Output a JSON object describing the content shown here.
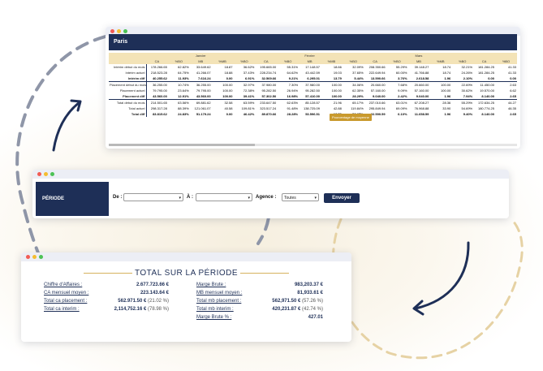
{
  "window1": {
    "header_title": "Paris",
    "months": [
      "Janvier",
      "Février",
      "Mars"
    ],
    "columns": [
      "CA",
      "%BO",
      "MB",
      "%MB",
      "%BO"
    ],
    "rows": [
      {
        "label": "Intérim début du mois",
        "values": [
          "178.266.65",
          "62.82%",
          "33.649.62",
          "18.87",
          "36.62%",
          "195.665.00",
          "55.31%",
          "17.148.57",
          "18.66",
          "32.09%",
          "208.350.66",
          "55.29%",
          "39.148.27",
          "18.74",
          "32.21%",
          "181.284.25",
          "41.33"
        ]
      },
      {
        "label": "Intérim actuel",
        "values": [
          "218.523.28",
          "64.75%",
          "41.266.07",
          "18.88",
          "37.43%",
          "228.234.74",
          "64.62%",
          "43.442.59",
          "19.03",
          "37.65%",
          "222.649.94",
          "60.00%",
          "41.766.88",
          "18.74",
          "24.26%",
          "181.284.25",
          "41.33"
        ]
      },
      {
        "label": "Intérim diff",
        "values": [
          "40.255.62",
          "11.93%",
          "7.616.24",
          "0.00",
          "6.91%",
          "32.569.66",
          "9.21%",
          "6.295.01",
          "13.79",
          "5.44%",
          "13.590.66",
          "3.76%",
          "2.618.58",
          "1.96",
          "2.10%",
          "0.00",
          "0.00"
        ]
      },
      {
        "label": "Placement début du mois",
        "values": [
          "36.255.00",
          "10.74%",
          "36.255.00",
          "100.00",
          "32.97%",
          "37.980.00",
          "7.30%",
          "37.980.00",
          "100.00",
          "34.06%",
          "20.660.00",
          "7.68%",
          "20.660.00",
          "100.00",
          "22.69%",
          "11.450.00",
          "2.63"
        ]
      },
      {
        "label": "Placement actuel",
        "values": [
          "79.795.00",
          "23.64%",
          "79.795.00",
          "100.00",
          "72.38%",
          "95.282.50",
          "26.94%",
          "95.282.50",
          "100.00",
          "62.35%",
          "57.160.00",
          "9.09%",
          "57.160.00",
          "100.00",
          "30.62%",
          "19.570.00",
          "6.62"
        ]
      },
      {
        "label": "Placement diff",
        "values": [
          "43.560.00",
          "12.91%",
          "43.560.00",
          "100.00",
          "39.41%",
          "57.302.50",
          "16.98%",
          "57.410.00",
          "100.00",
          "28.29%",
          "9.040.00",
          "2.42%",
          "9.040.00",
          "1.96",
          "7.94%",
          "8.140.00",
          "2.65"
        ]
      },
      {
        "label": "Total début du mois",
        "values": [
          "214.501.65",
          "63.56%",
          "69.881.62",
          "32.58",
          "63.59%",
          "233.647.50",
          "62.63%",
          "85.128.57",
          "21.96",
          "65.17%",
          "237.010.66",
          "63.01%",
          "67.208.27",
          "28.36",
          "55.29%",
          "172.634.25",
          "44.27"
        ]
      },
      {
        "label": "Total actuel",
        "values": [
          "298.317.28",
          "88.39%",
          "121.061.07",
          "40.58",
          "109.81%",
          "323.517.24",
          "91.48%",
          "138.725.09",
          "42.88",
          "119.84%",
          "295.849.94",
          "69.09%",
          "76.968.88",
          "33.90",
          "54.69%",
          "180.774.25",
          "46.35"
        ]
      },
      {
        "label": "Total diff",
        "values": [
          "83.815.62",
          "24.83%",
          "51.179.24",
          "0.00",
          "46.42%",
          "89.870.66",
          "28.28%",
          "53.596.51",
          "13.79",
          "53.67%",
          "22.590.59",
          "6.10%",
          "11.658.59",
          "1.96",
          "9.40%",
          "8.140.00",
          "2.65"
        ]
      }
    ],
    "tooltip": "Pourcentage de moyenne"
  },
  "window2": {
    "label": "PÉRIODE",
    "de_label": "De :",
    "a_label": "À :",
    "agence_label": "Agence :",
    "agence_value": "Toutes",
    "button": "Envoyer"
  },
  "window3": {
    "title": "TOTAL SUR LA PÉRIODE",
    "left": [
      {
        "label": "Chiffre d'Affaires :",
        "value": "2.677.723.66 €",
        "pct": ""
      },
      {
        "label": "CA mensuel moyen :",
        "value": "223.143.64 €",
        "pct": ""
      },
      {
        "label": "Total ca placement :",
        "value": "562.971.50 €",
        "pct": "(21.02 %)"
      },
      {
        "label": "Total ca interim :",
        "value": "2,114,752.16 €",
        "pct": "(78.98 %)"
      }
    ],
    "right": [
      {
        "label": "Marge Brute :",
        "value": "983,203.37 €",
        "pct": ""
      },
      {
        "label": "MB mensuel moyen :",
        "value": "81,933.61 €",
        "pct": ""
      },
      {
        "label": "Total mb placement :",
        "value": "562,971.50 €",
        "pct": "(57.26 %)"
      },
      {
        "label": "Total mb interim :",
        "value": "420,231.87 €",
        "pct": "(42.74 %)"
      },
      {
        "label": "Marge Brute % :",
        "value": "427.01",
        "pct": ""
      }
    ]
  }
}
